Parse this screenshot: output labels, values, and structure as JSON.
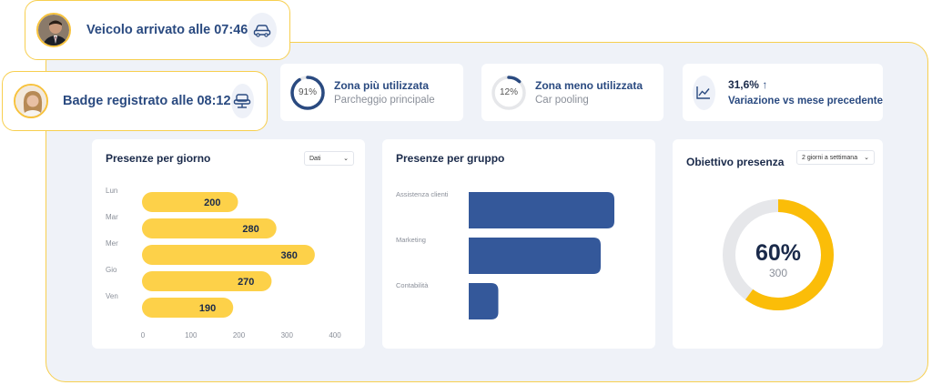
{
  "notifications": [
    {
      "text": "Veicolo arrivato alle 07:46",
      "icon": "car-icon"
    },
    {
      "text": "Badge registrato alle 08:12",
      "icon": "armchair-icon"
    }
  ],
  "kpis": {
    "most_used": {
      "percent_label": "91%",
      "percent": 91,
      "title": "Zona più utilizzata",
      "subtitle": "Parcheggio principale"
    },
    "least_used": {
      "percent_label": "12%",
      "percent": 12,
      "title": "Zona meno utilizzata",
      "subtitle": "Car pooling"
    },
    "variation": {
      "value": "31,6%",
      "arrow": "↑",
      "description": "Variazione vs mese precedente",
      "icon": "line-chart-icon"
    }
  },
  "presenze_giorno": {
    "title": "Presenze per giorno",
    "dropdown": "Dati",
    "chev": "⌄"
  },
  "presenze_gruppo": {
    "title": "Presenze per gruppo"
  },
  "obiettivo": {
    "title": "Obiettivo presenza",
    "dropdown": "2 giorni a settimana",
    "chev": "⌄",
    "percent_label": "60%",
    "count": "300",
    "percent": 60
  },
  "colors": {
    "accent_yellow": "#fdd149",
    "ring_yellow": "#fbbd08",
    "navy": "#34589a",
    "ring_blue": "#2a4a80",
    "track": "#e6e7ea"
  },
  "chart_data": [
    {
      "type": "bar",
      "orientation": "horizontal",
      "title": "Presenze per giorno",
      "categories": [
        "Lun",
        "Mar",
        "Mer",
        "Gio",
        "Ven"
      ],
      "values": [
        200,
        280,
        360,
        270,
        190
      ],
      "xlim": [
        0,
        400
      ],
      "xticks": [
        "0",
        "100",
        "200",
        "300",
        "400"
      ],
      "grid": false,
      "color": "#fdd149"
    },
    {
      "type": "bar",
      "orientation": "horizontal",
      "title": "Presenze per gruppo",
      "categories": [
        "Assistenza clienti",
        "Marketing",
        "Contabilità"
      ],
      "values": [
        320,
        290,
        65
      ],
      "color": "#34589a"
    }
  ]
}
